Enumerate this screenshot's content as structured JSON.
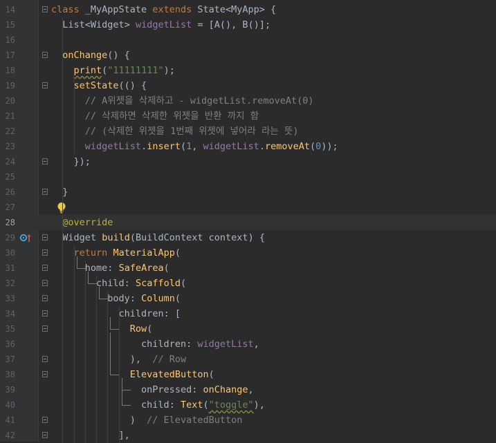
{
  "lines": [
    {
      "number": "14",
      "code": "class _MyAppState extends State<MyApp> {"
    },
    {
      "number": "15",
      "code": "  List<Widget> widgetList = [A(), B()];"
    },
    {
      "number": "16",
      "code": ""
    },
    {
      "number": "17",
      "code": "  onChange() {"
    },
    {
      "number": "18",
      "code": "    print(\"11111111\");"
    },
    {
      "number": "19",
      "code": "    setState(() {"
    },
    {
      "number": "20",
      "code": "      // A위젯을 삭제하고 - widgetList.removeAt(0)"
    },
    {
      "number": "21",
      "code": "      // 삭제하면 삭제한 위젯을 반환 까지 함"
    },
    {
      "number": "22",
      "code": "      // (삭제한 위젯을 1번째 위젯에 넣어라 라는 뜻)"
    },
    {
      "number": "23",
      "code": "      widgetList.insert(1, widgetList.removeAt(0));"
    },
    {
      "number": "24",
      "code": "    });"
    },
    {
      "number": "25",
      "code": ""
    },
    {
      "number": "26",
      "code": "  }"
    },
    {
      "number": "27",
      "code": ""
    },
    {
      "number": "28",
      "code": "  @override"
    },
    {
      "number": "29",
      "code": "  Widget build(BuildContext context) {"
    },
    {
      "number": "30",
      "code": "    return MaterialApp("
    },
    {
      "number": "31",
      "code": "      home: SafeArea("
    },
    {
      "number": "32",
      "code": "        child: Scaffold("
    },
    {
      "number": "33",
      "code": "          body: Column("
    },
    {
      "number": "34",
      "code": "            children: ["
    },
    {
      "number": "35",
      "code": "              Row("
    },
    {
      "number": "36",
      "code": "                children: widgetList,"
    },
    {
      "number": "37",
      "code": "              ),  // Row"
    },
    {
      "number": "38",
      "code": "              ElevatedButton("
    },
    {
      "number": "39",
      "code": "                onPressed: onChange,"
    },
    {
      "number": "40",
      "code": "                child: Text(\"toggle\"),"
    },
    {
      "number": "41",
      "code": "              )  // ElevatedButton"
    },
    {
      "number": "42",
      "code": "            ],"
    }
  ],
  "current_line": "28",
  "icons": {
    "intention": "lightbulb-icon",
    "gutter_marker": "override-marker-icon"
  },
  "colors": {
    "background": "#2b2b2b",
    "gutter": "#313335",
    "keyword": "#cc7832",
    "function": "#ffc66d",
    "field": "#9876aa",
    "string": "#6a8759",
    "number": "#6897bb",
    "comment": "#808080",
    "annotation": "#bbb529",
    "text": "#a9b7c6"
  }
}
